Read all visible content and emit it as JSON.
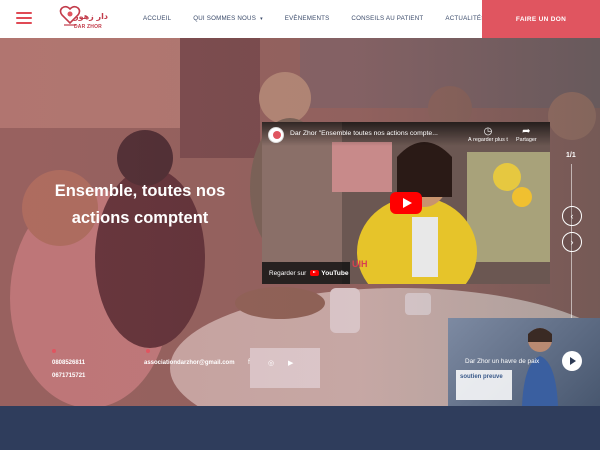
{
  "header": {
    "logo": {
      "arabic": "دار زهور",
      "latin": "DAR ZHOR"
    },
    "nav": [
      {
        "label": "ACCUEIL",
        "has_dropdown": false
      },
      {
        "label": "QUI SOMMES NOUS",
        "has_dropdown": true
      },
      {
        "label": "EVÈNEMENTS",
        "has_dropdown": false
      },
      {
        "label": "CONSEILS AU PATIENT",
        "has_dropdown": false
      },
      {
        "label": "ACTUALITÉS",
        "has_dropdown": false
      }
    ],
    "cta_label": "FAIRE UN DON"
  },
  "hero": {
    "title": "Ensemble, toutes nos actions comptent",
    "slide_counter": "1/1",
    "phones": [
      "0808526811",
      "0671715721"
    ],
    "email": "associationdarzhor@gmail.com"
  },
  "video": {
    "title": "Dar Zhor \"Ensemble toutes nos actions compte...",
    "watch_later": "À regarder plus tard",
    "share": "Partager",
    "watch_on": "Regarder sur",
    "youtube": "YouTube",
    "thumbnail_text": "UIH"
  },
  "thumbnail": {
    "caption": "Dar Zhor un havre de paix",
    "sign_text": "soutien preuve"
  },
  "colors": {
    "brand": "#e05560",
    "nav_text": "#3a4a6a",
    "footer": "#2f3d5c"
  },
  "icons": {
    "menu": "hamburger-icon",
    "prev": "chevron-left-icon",
    "next": "chevron-right-icon",
    "social": [
      "facebook-icon",
      "instagram-icon",
      "youtube-icon"
    ]
  }
}
